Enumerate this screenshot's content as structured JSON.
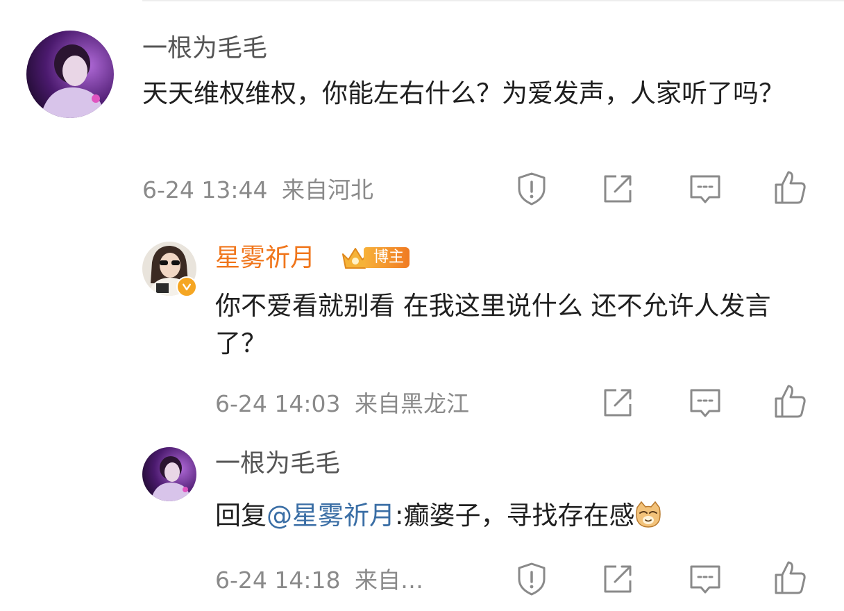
{
  "comment1": {
    "username": "一根为毛毛",
    "text": "天天维权维权，你能左右什么？为爱发声，人家听了吗？",
    "timestamp": "6-24 13:44",
    "location": "来自河北"
  },
  "reply1": {
    "username": "星雾祈月",
    "badge": "博主",
    "text": "你不爱看就别看 在我这里说什么 还不允许人发言了？",
    "timestamp": "6-24 14:03",
    "location": "来自黑龙江"
  },
  "reply2": {
    "username": "一根为毛毛",
    "reply_prefix": "回复",
    "mention": "@星雾祈月",
    "text": ":癫婆子，寻找存在感",
    "emoji": "cat-face-icon",
    "timestamp": "6-24 14:18",
    "location": "来自…"
  },
  "icons": {
    "report": "report-icon",
    "forward": "forward-icon",
    "comment": "comment-icon",
    "like": "like-icon"
  },
  "colors": {
    "blogger_name": "#f0761c",
    "mention": "#3a6ea5",
    "meta": "#8a8a8a",
    "icon": "#8a8a8a"
  }
}
